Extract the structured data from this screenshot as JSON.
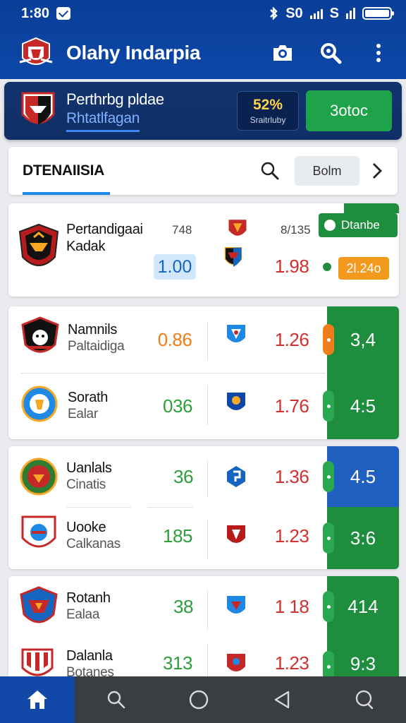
{
  "status_bar": {
    "time": "1:80",
    "network_text": "S0",
    "network_text2": "S"
  },
  "app_bar": {
    "title": "Olahy Indarpia",
    "icons": [
      "camera-icon",
      "search-icon",
      "more-vert-icon"
    ]
  },
  "banner": {
    "title": "Perthrbg pldae",
    "subtitle": "Rhtatlfagan",
    "odds_value": "52%",
    "odds_label": "Sraitrluby",
    "cta_label": "3otoc"
  },
  "filter_bar": {
    "tab_label": "DTENAIISIA",
    "button_label": "Bolm"
  },
  "featured_match": {
    "team_name": "Pertandigaai",
    "team_sub": "Kadak",
    "num_left": "748",
    "num_right": "8/135",
    "odd_home": "1.00",
    "odd_away": "1.98",
    "status_label": "Dtanbe",
    "badge_value": "2l.24o"
  },
  "match_groups": [
    {
      "rows": [
        {
          "team_name": "Namnils",
          "team_sub": "Paltaidiga",
          "odd_home": "0.86",
          "odd_away": "1.26",
          "panel_value": "3,4"
        },
        {
          "team_name": "Sorath",
          "team_sub": "Ealar",
          "odd_home": "036",
          "odd_away": "1.76",
          "panel_value": "4:5"
        }
      ]
    },
    {
      "rows": [
        {
          "team_name": "Uanlals",
          "team_sub": "Cinatis",
          "odd_home": "36",
          "odd_away": "1.36",
          "panel_value": "4.5"
        },
        {
          "team_name": "Uooke",
          "team_sub": "Calkanas",
          "odd_home": "185",
          "odd_away": "1.23",
          "panel_value": "3:6"
        }
      ]
    },
    {
      "rows": [
        {
          "team_name": "Rotanh",
          "team_sub": "Ealaa",
          "odd_home": "38",
          "odd_away": "1 18",
          "panel_value": "414"
        },
        {
          "team_name": "Dalanla",
          "team_sub": "Botanes",
          "odd_home": "313",
          "odd_away": "1.23",
          "panel_value": "9:3"
        }
      ]
    }
  ],
  "colors": {
    "primary_blue": "#0d47a8",
    "green": "#1e8e3e",
    "odd_red": "#d32f2f",
    "odd_orange": "#ef7d1a",
    "odd_green": "#2e9e3a",
    "badge_orange": "#f39a1e"
  },
  "bottom_nav": {
    "icons": [
      "home-icon",
      "search-icon",
      "circle-home-icon",
      "back-icon",
      "chat-icon"
    ]
  }
}
